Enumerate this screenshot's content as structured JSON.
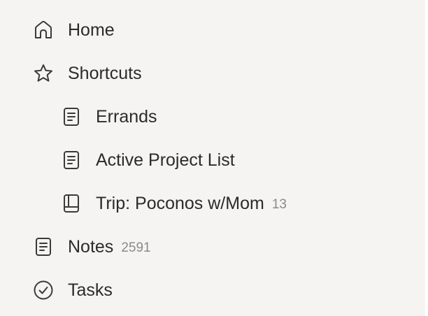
{
  "sidebar": {
    "home": {
      "label": "Home",
      "icon": "home-icon"
    },
    "shortcuts": {
      "label": "Shortcuts",
      "icon": "star-icon"
    },
    "shortcut_items": [
      {
        "label": "Errands",
        "icon": "note-icon"
      },
      {
        "label": "Active Project List",
        "icon": "note-icon"
      },
      {
        "label": "Trip: Poconos w/Mom",
        "icon": "notebook-icon",
        "count": "13"
      }
    ],
    "notes": {
      "label": "Notes",
      "icon": "note-icon",
      "count": "2591"
    },
    "tasks": {
      "label": "Tasks",
      "icon": "check-circle-icon"
    }
  },
  "colors": {
    "background": "#f5f4f2",
    "text": "#2b2b2b",
    "muted": "#8a8a86",
    "icon": "#3a3a3a"
  }
}
